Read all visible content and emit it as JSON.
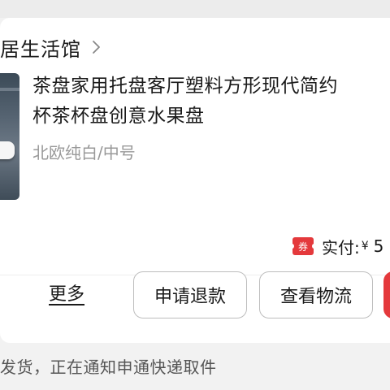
{
  "store": {
    "name": "居生活馆"
  },
  "product": {
    "title_line1": "茶盘家用托盘客厅塑料方形现代简约",
    "title_line2": "杯茶杯盘创意水果盘",
    "spec": "北欧纯白/中号"
  },
  "price": {
    "coupon_badge": "券",
    "label": "实付:",
    "currency": "¥",
    "value": "5"
  },
  "actions": {
    "more": "更多",
    "refund": "申请退款",
    "logistics": "查看物流"
  },
  "notice": {
    "text": "发货，正在通知申通快递取件"
  },
  "colors": {
    "accent_red": "#e4393c",
    "muted_text": "#999999",
    "background": "#f2f2f2"
  }
}
